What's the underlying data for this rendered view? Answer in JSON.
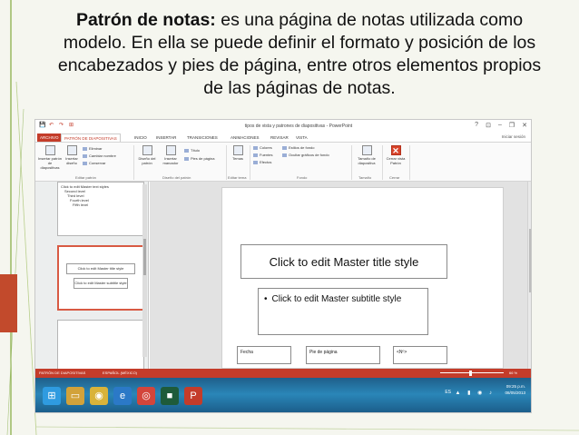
{
  "caption": {
    "bold_part": "Patrón de notas:",
    "line1_rest": " es una página de notas utilizada como",
    "line2": "modelo. En ella se puede definir el formato y posición de los",
    "line3": "encabezados y pies de página, entre otros elementos propios",
    "line4": "de las páginas de notas."
  },
  "window": {
    "title": "tipos de vista y patrones de diapositivas - PowerPoint",
    "quick_access": [
      "💾",
      "↶",
      "↷",
      "⊞"
    ],
    "buttons": [
      "?",
      "⊡",
      "–",
      "❐",
      "✕"
    ],
    "sign_in": "Iniciar sesión"
  },
  "tabs": {
    "file": "ARCHIVO",
    "active": "PATRÓN DE DIAPOSITIVAS",
    "others": [
      "INICIO",
      "INSERTAR",
      "TRANSICIONES",
      "ANIMACIONES",
      "REVISAR",
      "VISTA"
    ]
  },
  "ribbon": {
    "insert_slide_master": "Insertar patrón de diapositivas",
    "insert_layout": "Insertar diseño",
    "delete": "Eliminar",
    "rename": "Cambiar nombre",
    "preserve": "Conservar",
    "group_edit_master": "Editar patrón",
    "master_layout": "Diseño del patrón",
    "insert_placeholder": "Insertar marcador",
    "title_check": "Título",
    "footers_check": "Pies de página",
    "group_master_layout": "Diseño del patrón",
    "themes": "Temas",
    "group_edit_theme": "Editar tema",
    "colors": "Colores",
    "fonts": "Fuentes",
    "effects": "Efectos",
    "background_styles": "Estilos de fondo",
    "hide_bg": "Ocultar gráficos de fondo",
    "group_background": "Fondo",
    "slide_size": "Tamaño de diapositiva",
    "group_size": "Tamaño",
    "close_master": "Cerrar vista Patrón",
    "group_close": "Cerrar"
  },
  "thumbnails": {
    "thumb1_title": "Click to edit Master text styles",
    "thumb1_lines": [
      "Second level",
      "Third level",
      "Fourth level",
      "Fifth level"
    ],
    "thumb2_title": "Click to edit Master title style",
    "thumb2_sub": "Click to edit Master subtitle style"
  },
  "slide": {
    "title": "Click to edit Master title style",
    "subtitle_bullet": "•",
    "subtitle": "Click to edit Master subtitle style",
    "footer_date": "Fecha",
    "footer_text": "Pie de página",
    "footer_number": "<Nº>"
  },
  "statusbar": {
    "view": "PATRÓN DE DIAPOSITIVAS",
    "language": "ESPAÑOL (MÉXICO)",
    "zoom": "66 %"
  },
  "taskbar": {
    "items": [
      {
        "icon": "⊞",
        "color": "#2f9be0"
      },
      {
        "icon": "▭",
        "color": "#d2a23a"
      },
      {
        "icon": "◉",
        "color": "#d9b33a"
      },
      {
        "icon": "e",
        "color": "#2b79c7"
      },
      {
        "icon": "◎",
        "color": "#d3453b"
      },
      {
        "icon": "■",
        "color": "#1e5b3a"
      },
      {
        "icon": "P",
        "color": "#c43c2a"
      }
    ],
    "language": "ES",
    "time": "09:25 p.m.",
    "date": "08/05/2013"
  }
}
